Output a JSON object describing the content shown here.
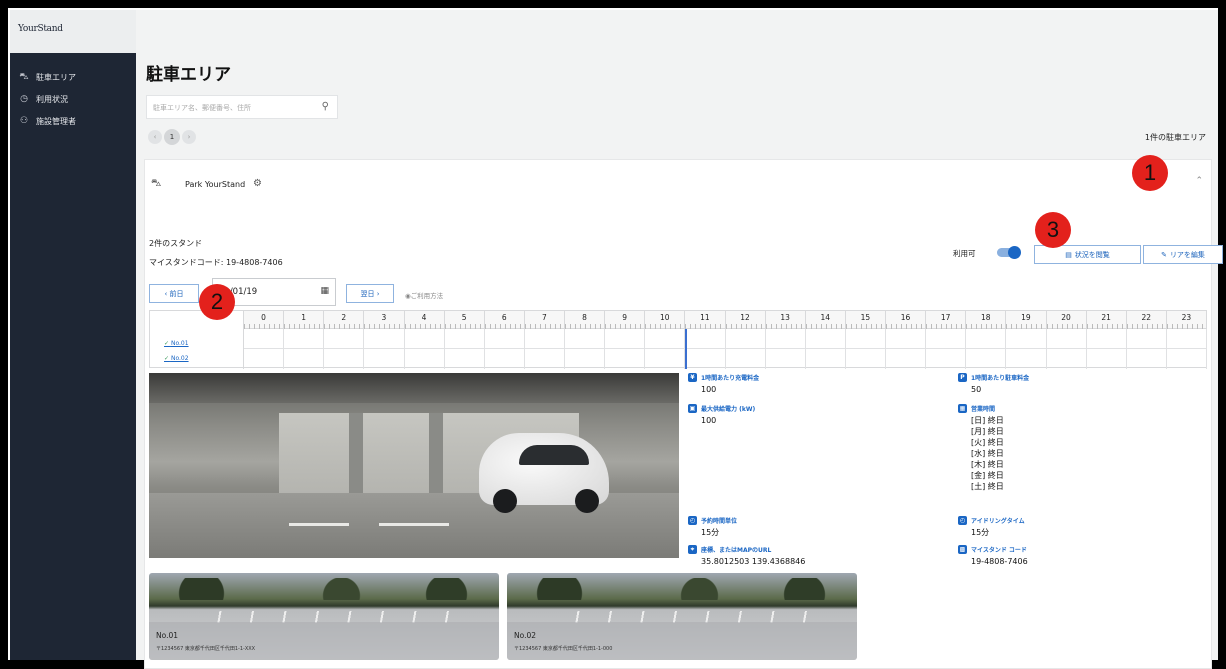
{
  "app": {
    "logo_text": "YourStand"
  },
  "sidebar": {
    "items": [
      {
        "icon": "parking-icon",
        "label": "駐車エリア"
      },
      {
        "icon": "history-icon",
        "label": "利用状況"
      },
      {
        "icon": "people-icon",
        "label": "施設管理者"
      }
    ]
  },
  "page": {
    "title": "駐車エリア",
    "search_placeholder": "駐車エリア名、郵便番号、住所",
    "pager": {
      "prev": "‹",
      "current": "1",
      "next": "›"
    },
    "result_count": "1件の駐車エリア"
  },
  "lot": {
    "name": "Park YourStand",
    "stand_count": "2件のスタンド",
    "mystand_code": "マイスタンドコード: 19-4808-7406",
    "available_label": "利用可",
    "available": true,
    "btn_status": "状況を閲覧",
    "btn_edit": "リアを編集",
    "prev_day": "‹ 前日",
    "date": "22/01/19",
    "next_day": "翌日 ›",
    "howto": "ご利用方法"
  },
  "timeline": {
    "hours": [
      "0",
      "1",
      "2",
      "3",
      "4",
      "5",
      "6",
      "7",
      "8",
      "9",
      "10",
      "11",
      "12",
      "13",
      "14",
      "15",
      "16",
      "17",
      "18",
      "19",
      "20",
      "21",
      "22",
      "23"
    ],
    "rows": [
      "No.01",
      "No.02"
    ]
  },
  "info": {
    "charge_fee_label": "1時間あたり充電料金",
    "charge_fee": "100",
    "parking_fee_label": "1時間あたり駐車料金",
    "parking_fee": "50",
    "max_power_label": "最大供給電力 (kW)",
    "max_power": "100",
    "hours_label": "営業時間",
    "hours": [
      "[日] 終日",
      "[月] 終日",
      "[火] 終日",
      "[水] 終日",
      "[木] 終日",
      "[金] 終日",
      "[土] 終日"
    ],
    "reserve_unit_label": "予約時間単位",
    "reserve_unit": "15分",
    "idle_label": "アイドリングタイム",
    "idle": "15分",
    "location_label": "座標、またはMAPのURL",
    "location": "35.8012503 139.4368846",
    "code_label": "マイスタンド コード",
    "code": "19-4808-7406"
  },
  "thumbs": [
    {
      "name": "No.01",
      "address": "〒1234567 東京都千代田区千代田1-1-XXX"
    },
    {
      "name": "No.02",
      "address": "〒1234567 東京都千代田区千代田1-1-000"
    }
  ],
  "callouts": [
    "1",
    "2",
    "3"
  ]
}
